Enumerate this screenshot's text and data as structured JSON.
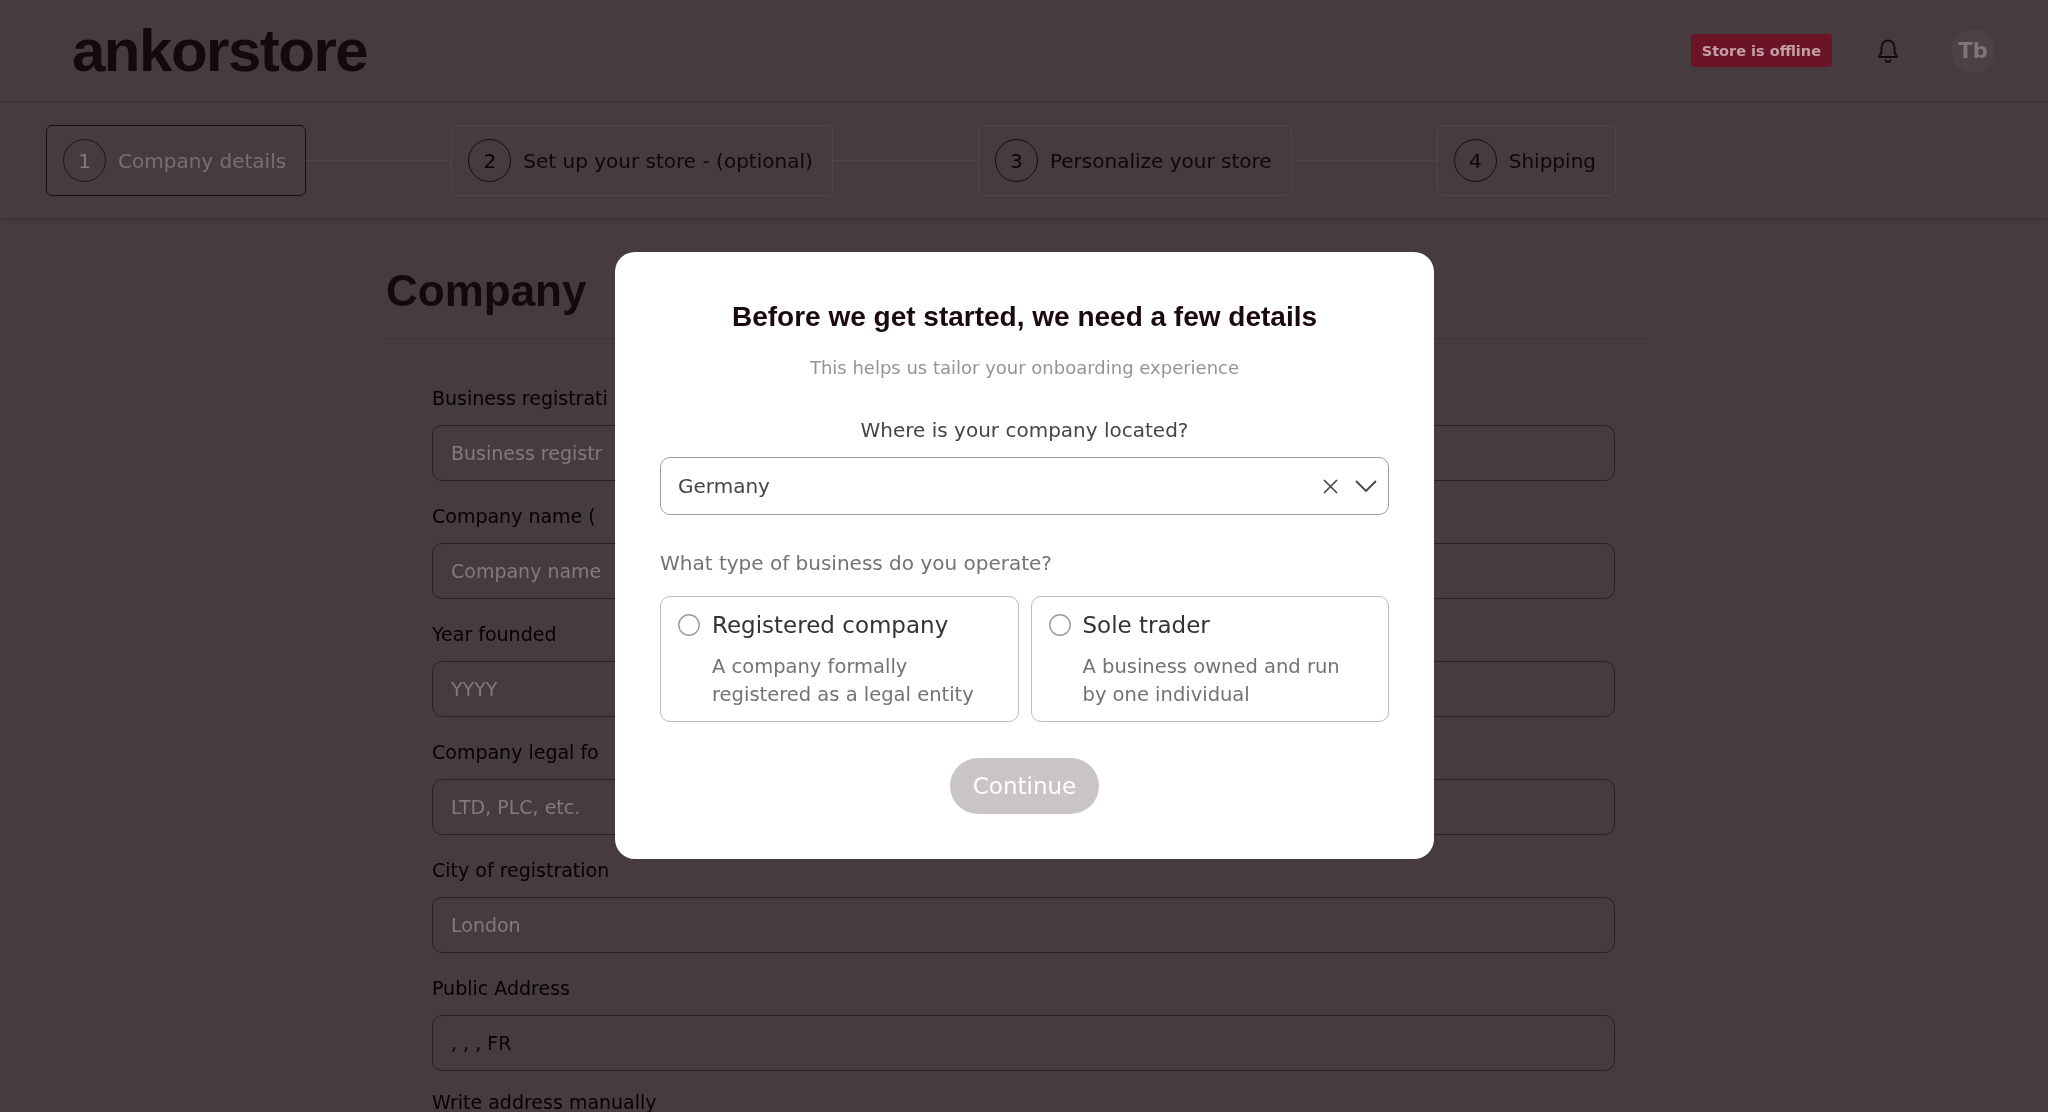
{
  "header": {
    "logo": "ankorstore",
    "status_badge": "Store is offline",
    "avatar": "Tb"
  },
  "steps": [
    {
      "number": "1",
      "label": "Company details",
      "selected": true
    },
    {
      "number": "2",
      "label": "Set up your store - (optional)",
      "selected": false
    },
    {
      "number": "3",
      "label": "Personalize your store",
      "selected": false
    },
    {
      "number": "4",
      "label": "Shipping",
      "selected": false
    }
  ],
  "form": {
    "title": "Company",
    "fields": [
      {
        "label": "Business registrati",
        "placeholder": "Business registr"
      },
      {
        "label": "Company name (",
        "placeholder": "Company name"
      },
      {
        "label": "Year founded",
        "placeholder": "YYYY"
      },
      {
        "label": "Company legal fo",
        "placeholder": "LTD, PLC, etc."
      },
      {
        "label": "City of registration",
        "placeholder": "London"
      },
      {
        "label": "Public Address",
        "value": ", , , FR"
      }
    ],
    "manual_address_link": "Write address manually"
  },
  "modal": {
    "title": "Before we get started, we need a few details",
    "subtitle": "This helps us tailor your onboarding experience",
    "location_question": "Where is your company located?",
    "country_select": {
      "value": "Germany"
    },
    "business_question": "What type of business do you operate?",
    "business_types": [
      {
        "title": "Registered company",
        "description": "A company formally registered as a legal entity",
        "selected": false
      },
      {
        "title": "Sole trader",
        "description": "A business owned and run by one individual",
        "selected": false
      }
    ],
    "continue_button": {
      "label": "Continue",
      "disabled": true
    }
  }
}
